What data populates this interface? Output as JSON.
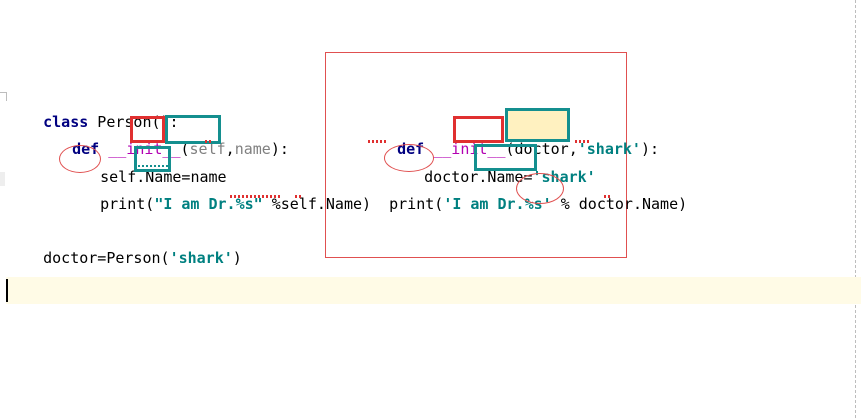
{
  "left_code": {
    "line1": {
      "kw": "class",
      "name": " Person():"
    },
    "line2": {
      "kw": "def",
      "fn": "__init__",
      "open": "(",
      "self": "self",
      "comma": ",",
      "param": "name",
      "close": "):"
    },
    "line3": {
      "self": "self",
      "rest": ".Name=",
      "param": "name"
    },
    "line4": {
      "prefix": "print(",
      "str": "\"I am Dr.%s\"",
      "rest": " %self.Name)"
    },
    "line5": {
      "prefix": "doctor=Person(",
      "str": "'shark'",
      "suffix": ")"
    }
  },
  "right_code": {
    "line1": {
      "kw": "def",
      "fn": "__init__",
      "open": "(",
      "doctor": "doctor",
      "comma": ",",
      "str": "'shark'",
      "close": "):"
    },
    "line2": {
      "doctor": "doctor",
      "rest": ".Name=",
      "str": "'shark'"
    },
    "line3": {
      "prefix": "print(",
      "str": "'I am Dr.%s'",
      "mid": " % ",
      "doctor": "doctor",
      "rest": ".Name)"
    }
  },
  "colors": {
    "keyword": "#000080",
    "function": "#b200b2",
    "string": "#008080",
    "annotation_red": "#e03030",
    "annotation_teal": "#148f8f",
    "current_line": "#fffbe6"
  }
}
